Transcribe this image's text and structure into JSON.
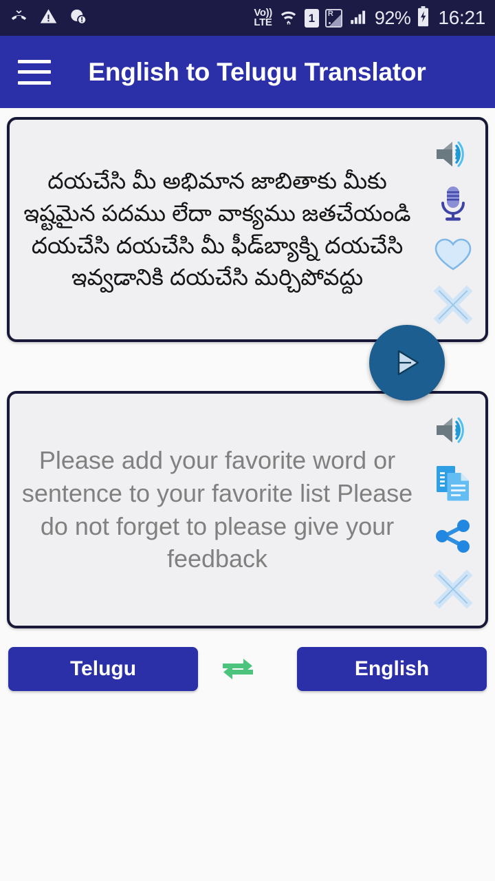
{
  "status_bar": {
    "left_icons": [
      "missed-call-icon",
      "warning-triangle-icon",
      "alert-info-icon"
    ],
    "volte_top": "Vo))",
    "volte_bottom": "LTE",
    "wifi": "wifi-icon",
    "sim_label": "1",
    "roaming_label": "R",
    "signal": "signal-bars-icon",
    "battery_percent": "92%",
    "battery": "battery-charging-icon",
    "time": "16:21"
  },
  "app_bar": {
    "menu_icon": "hamburger-menu-icon",
    "title": "English to Telugu Translator",
    "background_color": "#2b2fa8",
    "title_color": "#ffffff"
  },
  "source_card": {
    "text": "దయచేసి మీ అభిమాన జాబితాకు మీకు ఇష్టమైన పదము లేదా వాక్యము జతచేయండి దయచేసి దయచేసి మీ ఫీడ్‌బ్యాక్ని దయచేసి ఇవ్వడానికి దయచేసి మర్చిపోవద్దు",
    "text_color": "#161616",
    "background_color": "#f0f0f2",
    "border_color": "#181838",
    "actions": [
      {
        "name": "speak-source",
        "icon": "speaker-icon"
      },
      {
        "name": "voice-input",
        "icon": "microphone-icon"
      },
      {
        "name": "favorite-source",
        "icon": "heart-icon"
      },
      {
        "name": "clear-source",
        "icon": "close-x-icon"
      }
    ]
  },
  "translate_fab": {
    "icon": "send-icon",
    "background_color": "#1b5e8f"
  },
  "target_card": {
    "text": "Please add your favorite word or sentence to your favorite list Please do not forget to please give your feedback",
    "text_color": "#808080",
    "background_color": "#f0f0f2",
    "border_color": "#181838",
    "actions": [
      {
        "name": "speak-target",
        "icon": "speaker-icon"
      },
      {
        "name": "copy-target",
        "icon": "copy-documents-icon"
      },
      {
        "name": "share-target",
        "icon": "share-icon"
      },
      {
        "name": "clear-target",
        "icon": "close-x-icon"
      }
    ]
  },
  "language_bar": {
    "source_language": "Telugu",
    "target_language": "English",
    "swap_icon": "swap-arrows-icon",
    "button_color": "#2b2fa8",
    "swap_color": "#4cc47e"
  }
}
